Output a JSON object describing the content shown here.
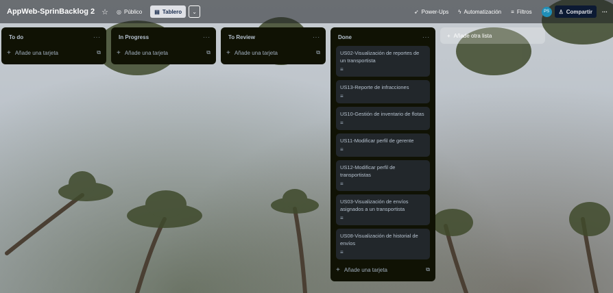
{
  "colors": {
    "topbar": "#1d2125",
    "list_bg": "#101204",
    "card_bg": "#22272b",
    "text": "#b6c2cf",
    "accent": "#0c66e4"
  },
  "header": {
    "board_title": "AppWeb-SprinBacklog 2",
    "visibility_label": "Público",
    "view_label": "Tablero",
    "power_ups": "Power-Ups",
    "automation": "Automatización",
    "filters": "Filtros",
    "avatar_initials": "PS",
    "share_label": "Compartir",
    "more": "···"
  },
  "lists": [
    {
      "title": "To do",
      "add_card": "Añade una tarjeta",
      "cards": []
    },
    {
      "title": "In Progress",
      "add_card": "Añade una tarjeta",
      "cards": []
    },
    {
      "title": "To Review",
      "add_card": "Añade una tarjeta",
      "cards": []
    },
    {
      "title": "Done",
      "add_card": "Añade una tarjeta",
      "cards": [
        "US02-Visualización de reportes de un transportista",
        "US13-Reporte de infracciones",
        "US10-Gestión de inventario de flotas",
        "US11-Modificar perfil de gerente",
        "US12-Modificar perfil de transportistas",
        "US03-Visualización de envíos asignados a un transportista",
        "US08-Visualización de historial de envíos"
      ]
    }
  ],
  "add_list_label": "Añade otra lista",
  "icons": {
    "star": "star-icon",
    "globe": "globe-icon",
    "board": "board-icon",
    "plus": "plus-icon",
    "template": "template-icon",
    "description": "description-icon"
  }
}
